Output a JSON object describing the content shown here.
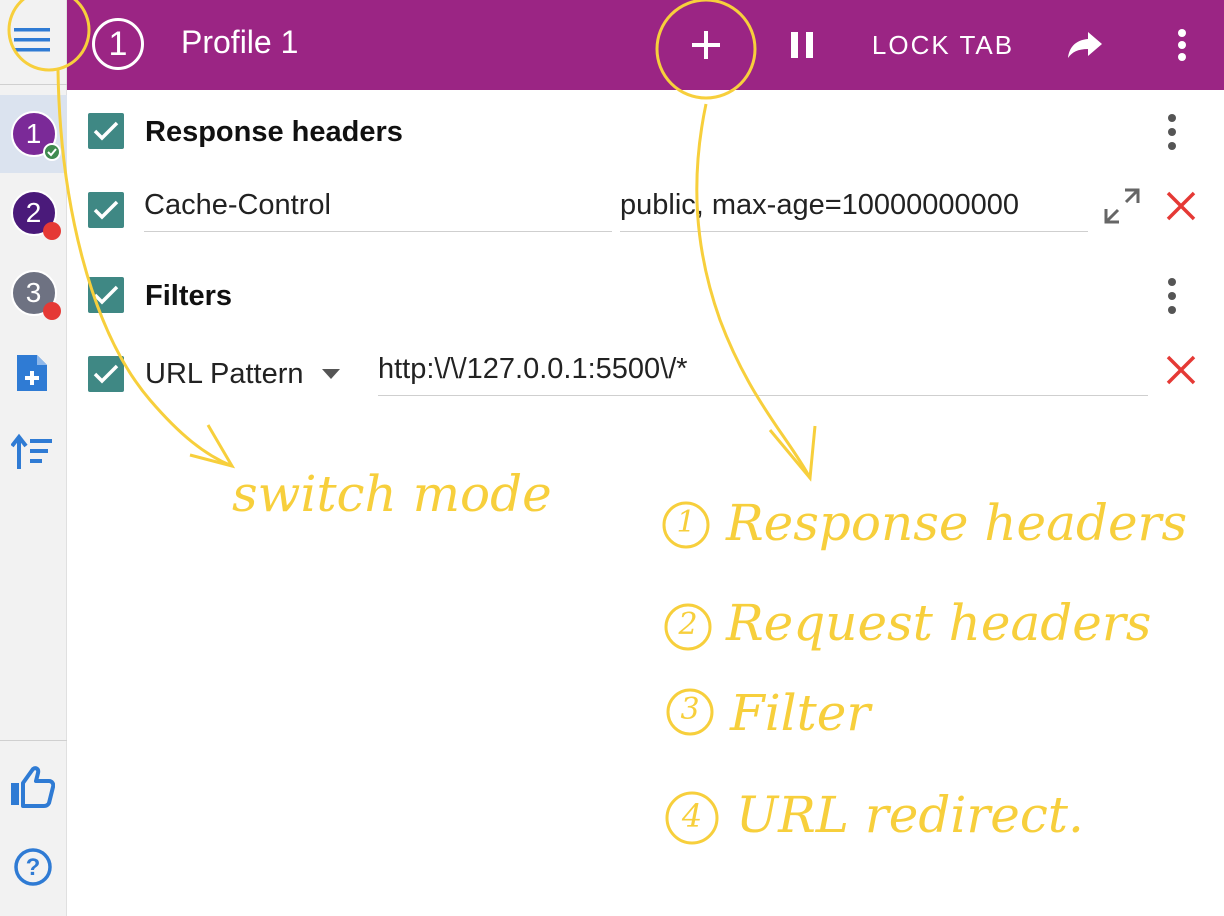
{
  "colors": {
    "topbar": "#9b2584",
    "checkbox": "#3f8884",
    "delete": "#e53935",
    "annotation": "#f7cf3c",
    "sidebar_icon": "#2f7bd4"
  },
  "topbar": {
    "profile_number": "1",
    "title": "Profile 1",
    "lock_tab_label": "LOCK TAB"
  },
  "sidebar": {
    "profiles": [
      {
        "label": "1",
        "color": "#7b2a98",
        "status": "active"
      },
      {
        "label": "2",
        "color": "#4a1a7a",
        "status": "inactive"
      },
      {
        "label": "3",
        "color": "#6e7282",
        "status": "inactive"
      }
    ],
    "icons": [
      "add-profile-icon",
      "sort-icon",
      "thumbs-up-icon",
      "help-icon"
    ]
  },
  "sections": {
    "response_headers": {
      "title": "Response headers",
      "rows": [
        {
          "name": "Cache-Control",
          "value": "public, max-age=10000000000"
        }
      ]
    },
    "filters": {
      "title": "Filters",
      "rows": [
        {
          "type": "URL Pattern",
          "value": "http:\\/\\/127.0.0.1:5500\\/*"
        }
      ]
    }
  },
  "annotations": {
    "switch_mode": "switch mode",
    "list": [
      {
        "num": "1",
        "text": "Response headers"
      },
      {
        "num": "2",
        "text": "Request headers"
      },
      {
        "num": "3",
        "text": "Filter"
      },
      {
        "num": "4",
        "text": "URL redirect."
      }
    ]
  }
}
